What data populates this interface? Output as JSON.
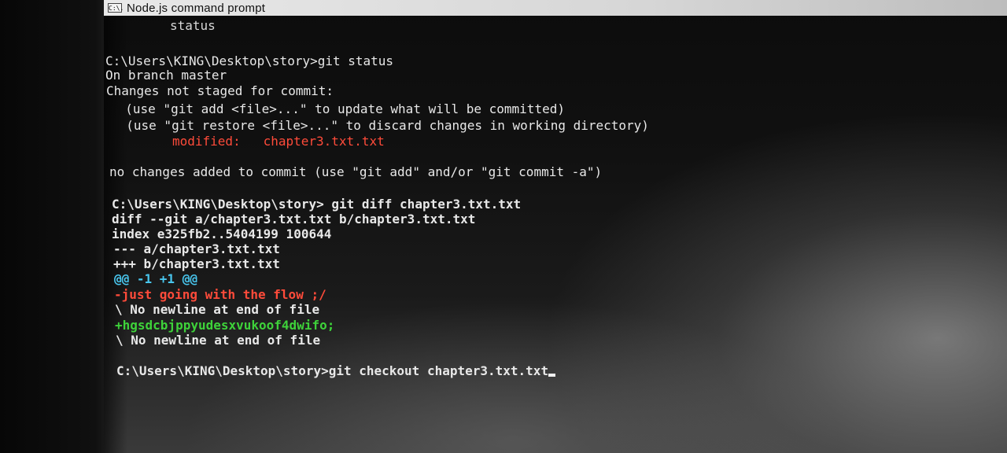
{
  "window": {
    "icon_label": "C:\\.",
    "title": "Node.js command prompt"
  },
  "terminal": {
    "lines": [
      "status",
      "C:\\Users\\KING\\Desktop\\story>git status",
      "On branch master",
      "Changes not staged for commit:",
      "  (use \"git add <file>...\" to update what will be committed)",
      "  (use \"git restore <file>...\" to discard changes in working directory)",
      "modified:   chapter3.txt.txt",
      "no changes added to commit (use \"git add\" and/or \"git commit -a\")",
      "C:\\Users\\KING\\Desktop\\story> git diff chapter3.txt.txt",
      "diff --git a/chapter3.txt.txt b/chapter3.txt.txt",
      "index e325fb2..5404199 100644",
      "--- a/chapter3.txt.txt",
      "+++ b/chapter3.txt.txt",
      "@@ -1 +1 @@",
      "-just going with the flow ;/",
      "\\ No newline at end of file",
      "+hgsdcbjppyudesxvukoof4dwifo;",
      "\\ No newline at end of file",
      "C:\\Users\\KING\\Desktop\\story>git checkout chapter3.txt.txt"
    ]
  },
  "colors": {
    "modified": "#ff4b3a",
    "removed": "#ff4b3a",
    "hunk_header": "#49c6ee",
    "added": "#3ed23a"
  }
}
